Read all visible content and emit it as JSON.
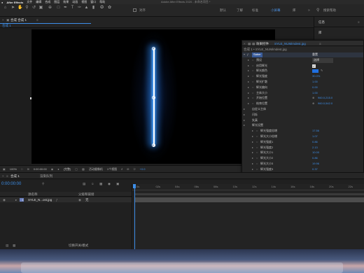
{
  "menubar": {
    "app_name": "After Effects",
    "items": [
      "文件",
      "编辑",
      "合成",
      "图层",
      "效果",
      "动画",
      "视图",
      "窗口",
      "帮助"
    ],
    "window_title": "Adobe After Effects 2020 - 未命名项目 *"
  },
  "toolbar": {
    "snap_label": "对齐",
    "workspaces": [
      "默认",
      "了解",
      "标准",
      "小屏幕",
      "库"
    ],
    "active_workspace": "小屏幕",
    "search_help": "搜索帮助"
  },
  "viewer": {
    "tab_label": "合成 合成 1",
    "breadcrumb": "合成 1",
    "zoom": "100%",
    "timecode": "0:00:00:00",
    "resolution": "(完整)",
    "camera": "活动摄像机",
    "views": "1个视图",
    "exposure": "+0.0"
  },
  "right_panel": {
    "info_label": "信息",
    "library_label": "库"
  },
  "effects_panel": {
    "tab_label": "效果控件",
    "layer_name": "SYLE_NUMimdest.jpg",
    "breadcrumb": "合成 1 • SYLE_NUMimdest.jpg",
    "rows": [
      {
        "label": "Saber",
        "value": "重置",
        "indent": 0,
        "kind": "effect"
      },
      {
        "label": "预设",
        "value": "选择",
        "indent": 1,
        "kind": "param"
      },
      {
        "label": "启用辉光",
        "value": "",
        "indent": 1,
        "kind": "checkbox"
      },
      {
        "label": "辉光颜色",
        "value": "",
        "indent": 1,
        "kind": "color"
      },
      {
        "label": "辉光强度",
        "value": "30.0%",
        "indent": 1,
        "kind": "param"
      },
      {
        "label": "辉光扩散",
        "value": "1.00",
        "indent": 1,
        "kind": "param"
      },
      {
        "label": "辉光偏向",
        "value": "0.00",
        "indent": 1,
        "kind": "param"
      },
      {
        "label": "主体大小",
        "value": "1.00",
        "indent": 1,
        "kind": "param"
      },
      {
        "label": "开始位置",
        "value": "960.0,215.0",
        "indent": 1,
        "kind": "point"
      },
      {
        "label": "结束位置",
        "value": "960.0,542.0",
        "indent": 1,
        "kind": "point"
      },
      {
        "label": "自定义主体",
        "value": "",
        "indent": 0,
        "kind": "group"
      },
      {
        "label": "闪烁",
        "value": "",
        "indent": 0,
        "kind": "group"
      },
      {
        "label": "失真",
        "value": "",
        "indent": 0,
        "kind": "group"
      },
      {
        "label": "辉光设置",
        "value": "",
        "indent": 0,
        "kind": "group"
      },
      {
        "label": "辉光强度倍增",
        "value": "17.56",
        "indent": 2,
        "kind": "param"
      },
      {
        "label": "辉光大小倍增",
        "value": "1.07",
        "indent": 2,
        "kind": "param"
      },
      {
        "label": "辉光强度1",
        "value": "0.86",
        "indent": 2,
        "kind": "param"
      },
      {
        "label": "辉光强度2",
        "value": "2.13",
        "indent": 2,
        "kind": "param"
      },
      {
        "label": "辉光大小1",
        "value": "10.00",
        "indent": 2,
        "kind": "param"
      },
      {
        "label": "辉光大小2",
        "value": "0.86",
        "indent": 2,
        "kind": "param"
      },
      {
        "label": "辉光大小3",
        "value": "19.96",
        "indent": 2,
        "kind": "param"
      },
      {
        "label": "辉光强度3",
        "value": "0.37",
        "indent": 2,
        "kind": "param"
      },
      {
        "label": "辉光大小4",
        "value": "8.04",
        "indent": 2,
        "kind": "param"
      },
      {
        "label": "辉光强度4",
        "value": "0.16",
        "indent": 2,
        "kind": "param"
      }
    ],
    "accent_color": "#3d8ee8",
    "swatch_color": "#1f6fe0"
  },
  "timeline": {
    "tab_label": "合成 1",
    "render_queue_label": "渲染队列",
    "timecode": "0:00:00:00",
    "col_source": "源名称",
    "col_parent": "父级和链接",
    "layer_index": "1",
    "layer_name": "SYLE_N...ost.jpg",
    "parent_value": "无",
    "footer_label": "切换开关/模式",
    "ruler_ticks": [
      "0s",
      "02s",
      "04s",
      "06s",
      "08s",
      "10s",
      "12s",
      "14s",
      "16s",
      "18s",
      "20s",
      "22s"
    ]
  },
  "saber": {
    "color": "#2c8dff",
    "core_color": "#ffffff"
  }
}
